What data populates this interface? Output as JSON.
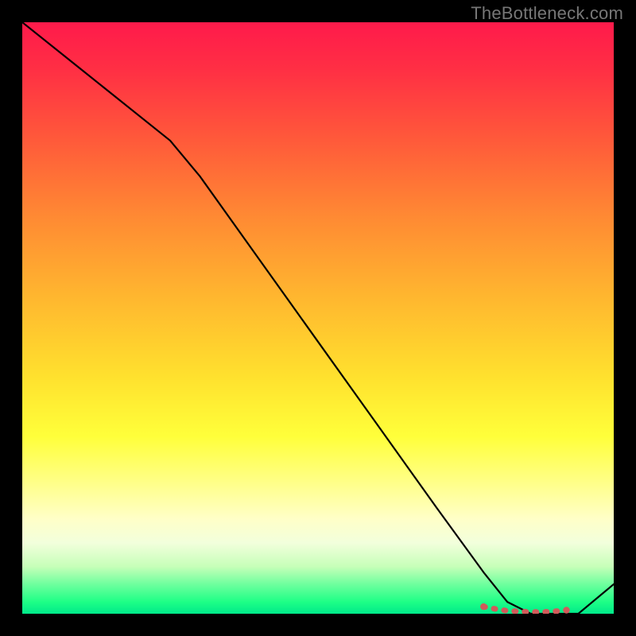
{
  "watermark": "TheBottleneck.com",
  "chart_data": {
    "type": "line",
    "title": "",
    "xlabel": "",
    "ylabel": "",
    "xlim": [
      0,
      100
    ],
    "ylim": [
      0,
      100
    ],
    "series": [
      {
        "name": "bottleneck-curve",
        "color": "#000000",
        "x": [
          0,
          10,
          25,
          30,
          40,
          50,
          60,
          70,
          78,
          82,
          86,
          90,
          94,
          100
        ],
        "y": [
          100,
          92,
          80,
          74,
          60,
          46,
          32,
          18,
          7,
          2,
          0,
          0,
          0,
          5
        ]
      }
    ],
    "markers": {
      "name": "optimal-range",
      "color": "#d15a5a",
      "x": [
        78,
        80,
        82,
        84,
        86,
        88,
        90,
        92
      ],
      "y": [
        1.2,
        0.8,
        0.5,
        0.4,
        0.3,
        0.3,
        0.4,
        0.6
      ]
    }
  }
}
